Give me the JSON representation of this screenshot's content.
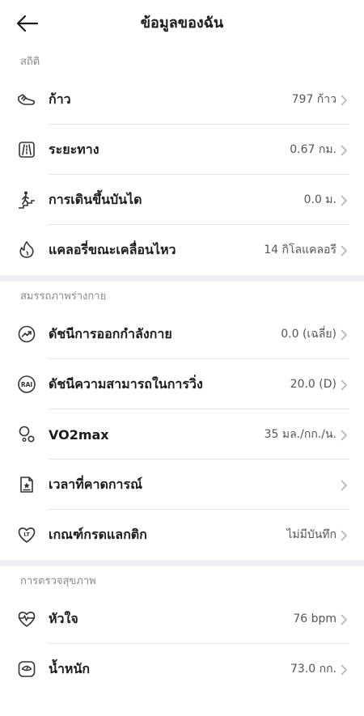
{
  "header": {
    "title": "ข้อมูลของฉัน"
  },
  "sections": [
    {
      "title": "สถิติ",
      "items": [
        {
          "label": "ก้าว",
          "value": "797 ก้าว",
          "icon": "shoe-icon"
        },
        {
          "label": "ระยะทาง",
          "value": "0.67 กม.",
          "icon": "road-icon"
        },
        {
          "label": "การเดินขึ้นบันได",
          "value": "0.0 ม.",
          "icon": "stairs-icon"
        },
        {
          "label": "แคลอรี่ขณะเคลื่อนไหว",
          "value": "14 กิโลแคลอรี",
          "icon": "flame-icon"
        }
      ]
    },
    {
      "title": "สมรรถภาพร่างกาย",
      "items": [
        {
          "label": "ดัชนีการออกกำลังกาย",
          "value": "0.0 (เฉลี่ย)",
          "icon": "trend-icon"
        },
        {
          "label": "ดัชนีความสามารถในการวิ่ง",
          "value": "20.0 (D)",
          "icon": "rai-icon",
          "badge": "RAI"
        },
        {
          "label": "VO2max",
          "value": "35 มล./กก./น.",
          "icon": "bubbles-icon"
        },
        {
          "label": "เวลาที่คาดการณ์",
          "value": "",
          "icon": "document-star-icon"
        },
        {
          "label": "เกณฑ์กรดแลกติก",
          "value": "ไม่มีบันทึก",
          "icon": "heart-lt-icon",
          "badge": "LT"
        }
      ]
    },
    {
      "title": "การตรวจสุขภาพ",
      "items": [
        {
          "label": "หัวใจ",
          "value": "76 bpm",
          "icon": "heartbeat-icon"
        },
        {
          "label": "น้ำหนัก",
          "value": "73.0 กก.",
          "icon": "scale-icon"
        }
      ]
    }
  ]
}
